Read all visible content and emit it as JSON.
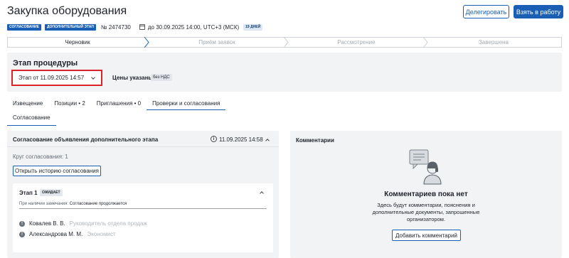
{
  "header": {
    "title": "Закупка оборудования",
    "delegate_label": "Делегировать",
    "work_label": "Взять в работу"
  },
  "meta": {
    "tag_approval": "СОГЛАСОВАНИЕ",
    "tag_extra_stage": "ДОПОЛНИТЕЛЬНЫЙ ЭТАП",
    "number": "№ 2474730",
    "calendar_icon": "calendar-icon",
    "deadline": "до 30.09.2025 14:00, UTC+3 (МСК)",
    "days_badge": "19 ДНЕЙ"
  },
  "stepper": {
    "steps": [
      "Черновик",
      "Приём заявок",
      "Рассмотрение",
      "Завершена"
    ],
    "active_index": 0
  },
  "stage": {
    "title": "Этап процедуры",
    "selected": "Этап от 11.09.2025 14:57",
    "prices_label": "Цены указаны:",
    "vat_badge": "без НДС"
  },
  "tabs": {
    "items": [
      "Извещение",
      "Позиции • 2",
      "Приглашения • 0",
      "Проверки и согласования"
    ],
    "active_index": 3,
    "subtab": "Согласование"
  },
  "approval": {
    "title": "Согласование объявления дополнительного этапа",
    "date": "11.09.2025 14:58",
    "round": "Круг согласования: 1",
    "history_button": "Открыть историю согласования",
    "stage_card": {
      "name": "Этап 1",
      "status": "ОЖИДАЕТ",
      "remark_label": "При наличии замечания:",
      "remark_value": "Согласование продолжается",
      "people": [
        {
          "name": "Ковалев В. В.",
          "role": "Руководитель отдела продаж"
        },
        {
          "name": "Александрова М. М.",
          "role": "Экономист"
        }
      ]
    }
  },
  "comments": {
    "title": "Комментарии",
    "illustration_icon": "comment-person-icon",
    "empty_title": "Комментариев пока нет",
    "empty_desc": "Здесь будут комментарии, пояснения и дополнительные документы, запрошенные организатором.",
    "add_button": "Добавить комментарий"
  },
  "colors": {
    "accent": "#1a5fb4",
    "highlight_border": "#d9222a",
    "panel_bg": "#f1f3f5"
  }
}
